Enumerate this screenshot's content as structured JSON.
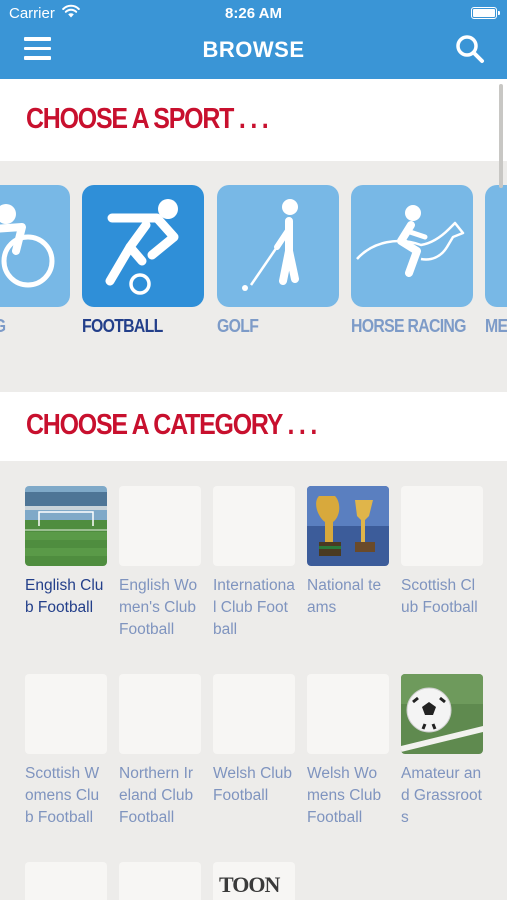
{
  "status_bar": {
    "carrier": "Carrier",
    "time": "8:26 AM"
  },
  "nav": {
    "title": "BROWSE",
    "menu_icon": "hamburger-menu-icon",
    "search_icon": "search-icon"
  },
  "colors": {
    "nav_bar": "#3a95d6",
    "heading_red": "#c8102e",
    "selected_label": "#233f8a",
    "unselected_label": "#7d9bc8",
    "tile_selected": "#2f8fd8",
    "tile_unselected": "#78b8e6"
  },
  "sports_section": {
    "heading": "CHOOSE A SPORT . . .",
    "sports": [
      {
        "label": "CYCLING",
        "visible_label": "G",
        "icon": "cycling-icon",
        "selected": false
      },
      {
        "label": "FOOTBALL",
        "icon": "football-icon",
        "selected": true
      },
      {
        "label": "GOLF",
        "icon": "golf-icon",
        "selected": false
      },
      {
        "label": "HORSE RACING",
        "icon": "horse-racing-icon",
        "selected": false
      },
      {
        "label": "ME",
        "icon": "sport-icon",
        "selected": false
      }
    ]
  },
  "category_section": {
    "heading": "CHOOSE A CATEGORY . . .",
    "categories": [
      {
        "name": "English Club Football",
        "thumb": "stadium-pitch-photo",
        "active": true
      },
      {
        "name": "English Women's Club Football",
        "thumb": "blank"
      },
      {
        "name": "International Club Football",
        "thumb": "blank"
      },
      {
        "name": "National teams",
        "thumb": "world-cup-trophies-photo"
      },
      {
        "name": "Scottish Club Football",
        "thumb": "blank"
      },
      {
        "name": "Scottish Womens Club Football",
        "thumb": "blank"
      },
      {
        "name": "Northern Ireland Club Football",
        "thumb": "blank"
      },
      {
        "name": "Welsh Club Football",
        "thumb": "blank"
      },
      {
        "name": "Welsh Womens Club Football",
        "thumb": "blank"
      },
      {
        "name": "Amateur and Grassroots",
        "thumb": "football-on-grass-photo"
      },
      {
        "name": "",
        "thumb": "blank"
      },
      {
        "name": "",
        "thumb": "blank"
      },
      {
        "name": "",
        "thumb": "toon-logo",
        "thumb_text": "TOON"
      }
    ]
  }
}
